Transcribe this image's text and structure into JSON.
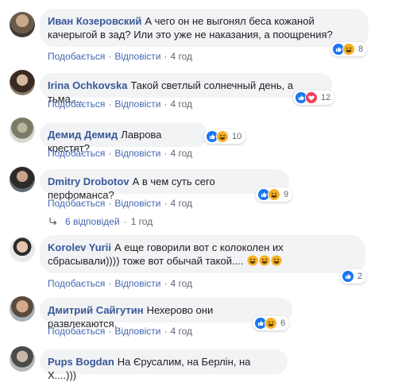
{
  "comments": [
    {
      "author": "Иван Козеровский",
      "text": "А чего он не выгонял беса кожаной качерыгой в зад? Или это уже не наказания, а поощрения?",
      "like_label": "Подобається",
      "reply_label": "Відповісти",
      "time": "4 год",
      "reaction_count": "8",
      "reactions": [
        "like-icon",
        "haha-icon"
      ]
    },
    {
      "author": "Irina Ochkovska",
      "text": "Такой светлый солнечный день, а тьма....",
      "like_label": "Подобається",
      "reply_label": "Відповісти",
      "time": "4 год",
      "reaction_count": "12",
      "reactions": [
        "like-icon",
        "love-icon"
      ]
    },
    {
      "author": "Демид Демид",
      "text": "Лаврова крестят?",
      "like_label": "Подобається",
      "reply_label": "Відповісти",
      "time": "4 год",
      "reaction_count": "10",
      "reactions": [
        "like-icon",
        "haha-icon"
      ]
    },
    {
      "author": "Dmitry Drobotov",
      "text": "А в чем суть сего перфоманса?",
      "like_label": "Подобається",
      "reply_label": "Відповісти",
      "time": "4 год",
      "reaction_count": "9",
      "reactions": [
        "like-icon",
        "haha-icon"
      ]
    },
    {
      "author": "Korolev Yurii",
      "text": "А еще говорили вот с колоколен их сбрасывали)))) тоже вот обычай такой....",
      "like_label": "Подобається",
      "reply_label": "Відповісти",
      "time": "4 год",
      "reaction_count": "2",
      "reactions": [
        "like-icon"
      ]
    },
    {
      "author": "Дмитрий Сайгутин",
      "text": "Нехерово они развлекаются.",
      "like_label": "Подобається",
      "reply_label": "Відповісти",
      "time": "4 год",
      "reaction_count": "6",
      "reactions": [
        "like-icon",
        "haha-icon"
      ]
    },
    {
      "author": "Pups Bogdan",
      "text": "На Єрусалим, на Берлін, на Х....)))"
    }
  ],
  "replies_link": {
    "label": "6 відповідей",
    "time": "1 год"
  },
  "colors": {
    "link": "#385898",
    "bubble": "#f2f3f5",
    "like": "#1877f2",
    "love": "#f33e58",
    "haha": "#f7b125"
  }
}
